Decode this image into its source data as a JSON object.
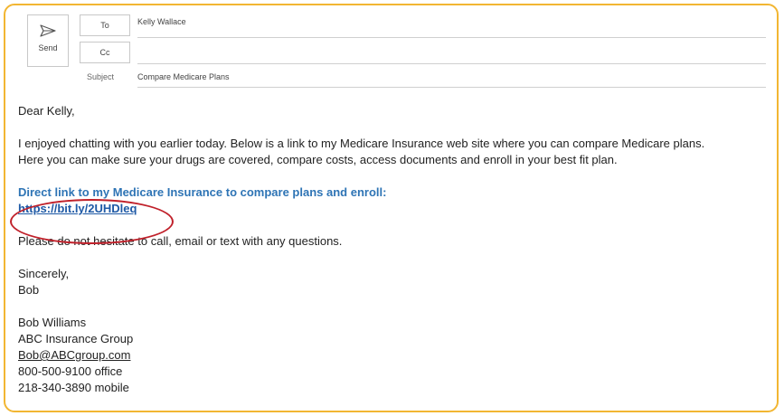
{
  "compose": {
    "send_label": "Send",
    "to_label": "To",
    "cc_label": "Cc",
    "subject_label": "Subject",
    "to_value": "Kelly Wallace",
    "cc_value": "",
    "subject_value": "Compare Medicare Plans"
  },
  "message": {
    "greeting": "Dear Kelly,",
    "para1_line1": "I enjoyed chatting with you earlier today. Below is a link to my Medicare Insurance web site where you can compare Medicare plans.",
    "para1_line2": "Here you can make sure your drugs are covered, compare costs, access documents and enroll in your best fit plan.",
    "link_heading": "Direct link to my Medicare Insurance to compare plans and enroll:",
    "link_url": "https://bit.ly/2UHDleq",
    "para2": "Please do not hesitate to call, email or text with any questions.",
    "closing": "Sincerely,",
    "sign_short": "Bob",
    "sig_name": "Bob Williams",
    "sig_company": "ABC Insurance Group",
    "sig_email": "Bob@ABCgroup.com",
    "sig_office": "800-500-9100  office",
    "sig_mobile": "218-340-3890  mobile"
  },
  "colors": {
    "frame_border": "#f2b632",
    "highlight_circle": "#c0202a",
    "link_blue": "#2e74b5"
  },
  "icons": {
    "send": "paper-plane-icon"
  }
}
